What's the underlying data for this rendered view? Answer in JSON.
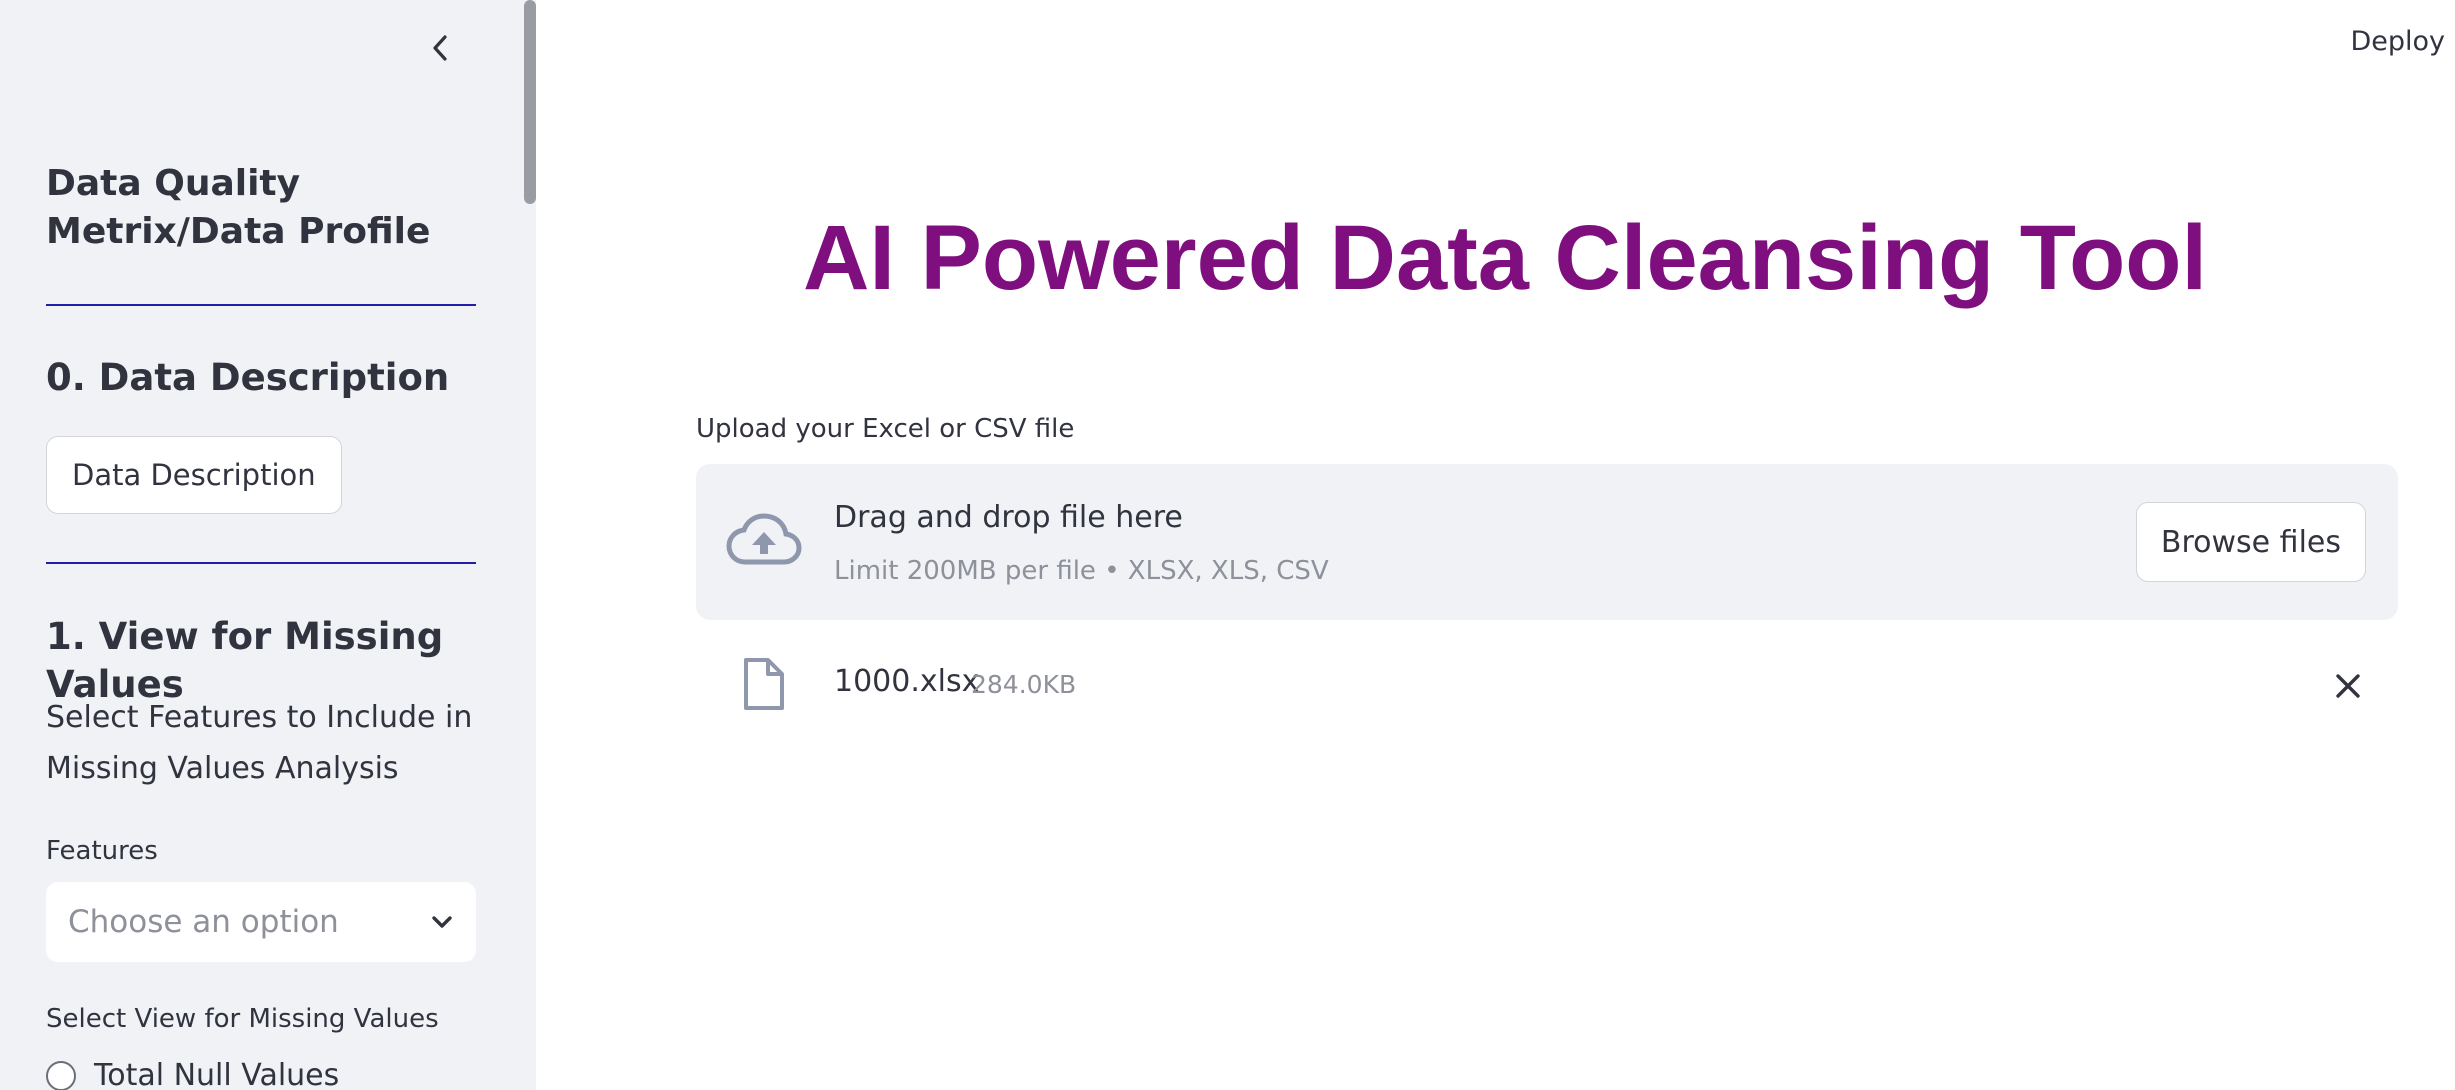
{
  "header": {
    "deploy_label": "Deploy"
  },
  "sidebar": {
    "collapse_icon": "chevron-left-icon",
    "title": "Data Quality Metrix/Data Profile",
    "section0": {
      "heading": "0. Data Description",
      "button_label": "Data Description"
    },
    "section1": {
      "heading": "1. View for Missing Values",
      "description": "Select Features to Include in Missing Values Analysis",
      "features_label": "Features",
      "features_placeholder": "Choose an option",
      "view_label": "Select View for Missing Values",
      "radio_options": [
        "Total Null Values"
      ]
    }
  },
  "main": {
    "title": "AI Powered Data Cleansing Tool",
    "title_color": "#7f0f7e",
    "uploader": {
      "label": "Upload your Excel or CSV file",
      "drop_text": "Drag and drop file here",
      "limit_text": "Limit 200MB per file • XLSX, XLS, CSV",
      "browse_label": "Browse files",
      "icon": "cloud-upload-icon"
    },
    "file": {
      "name": "1000.xlsx",
      "size": "284.0KB",
      "icon": "file-icon",
      "remove_icon": "close-icon"
    }
  },
  "colors": {
    "sidebar_bg": "#f0f2f6",
    "divider": "#1f1fa8",
    "text": "#31333f",
    "muted": "#8e909a"
  }
}
